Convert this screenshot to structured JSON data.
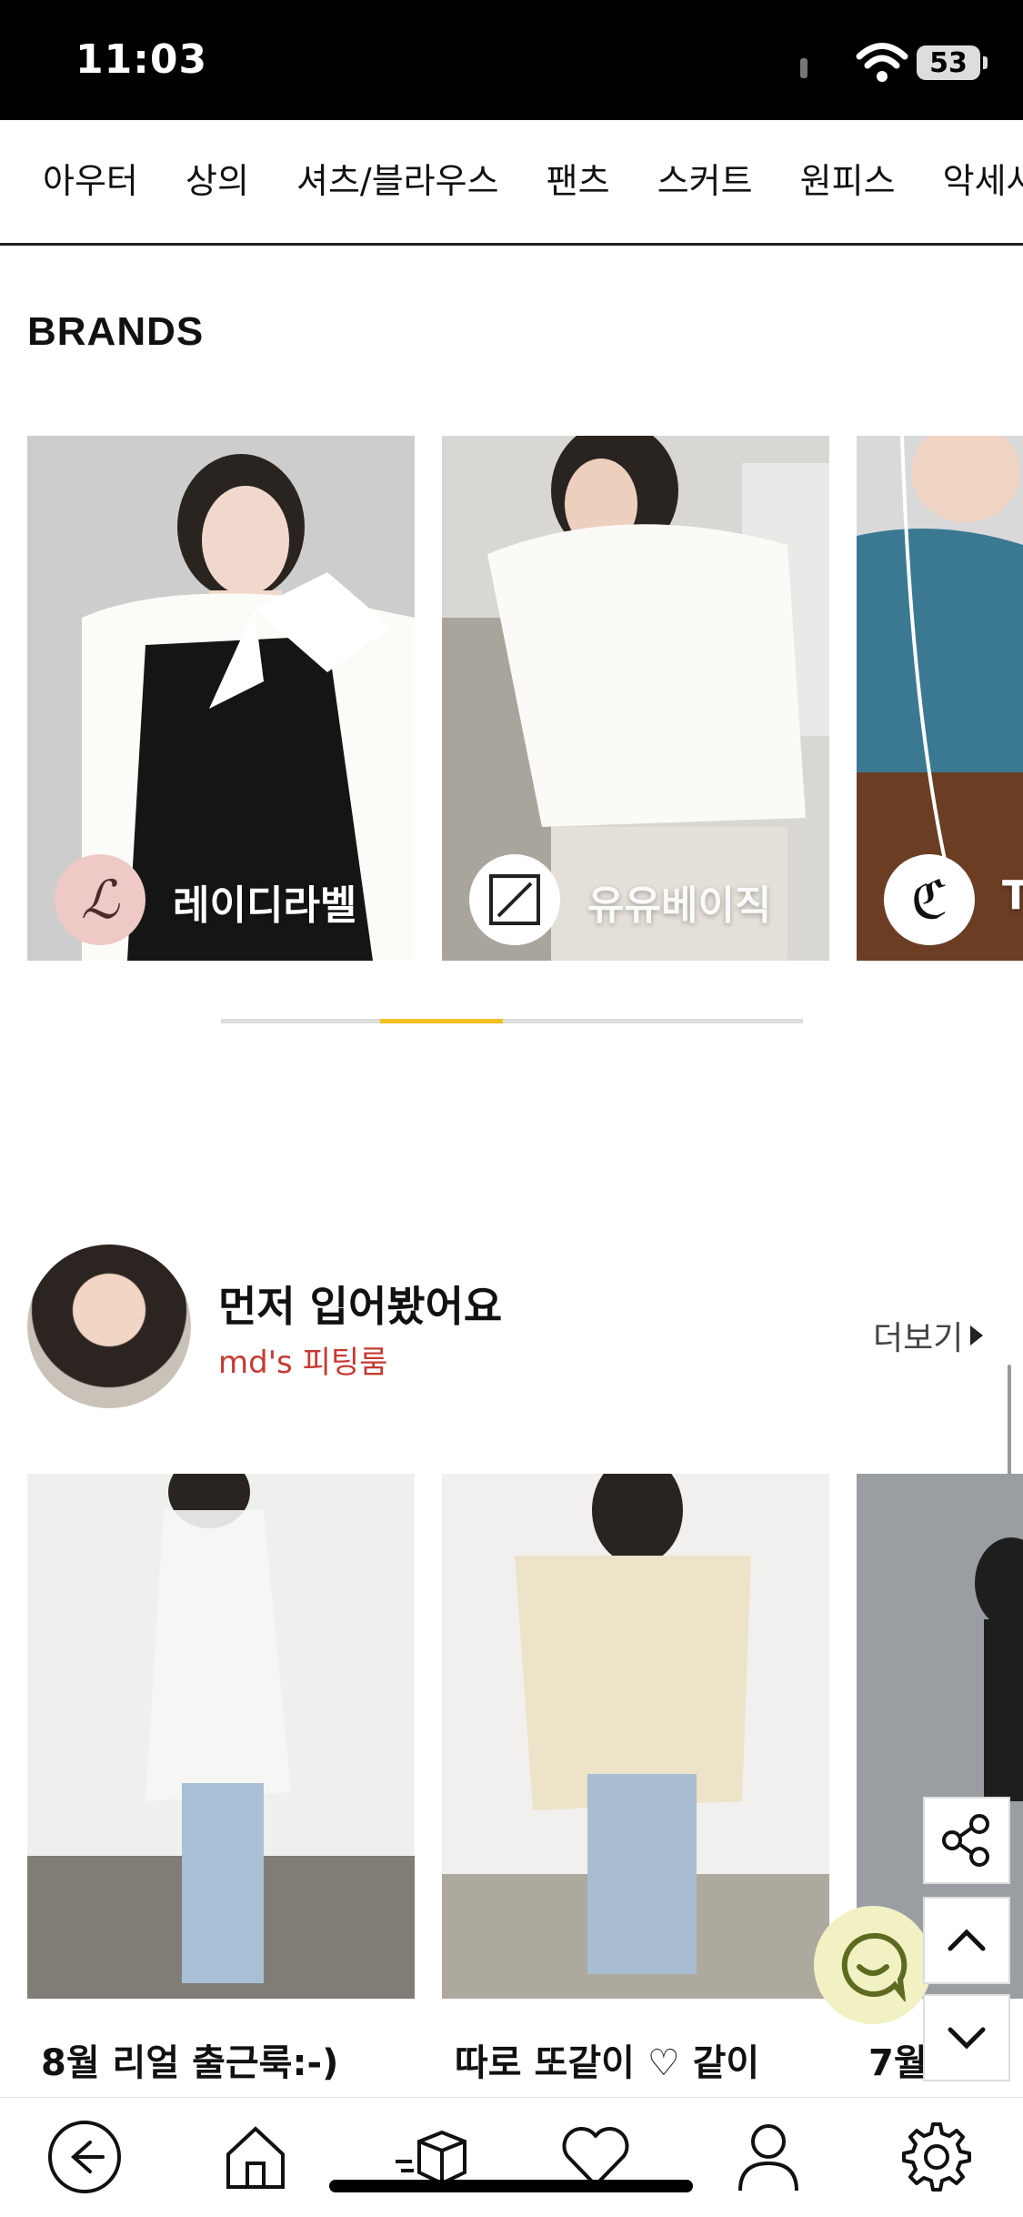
{
  "status_bar": {
    "time": "11:03",
    "battery": "53"
  },
  "categories": [
    "아우터",
    "상의",
    "셔츠/블라우스",
    "팬츠",
    "스커트",
    "원피스",
    "악세사"
  ],
  "brands": {
    "title": "BRANDS",
    "items": [
      {
        "name": "레이디라벨",
        "logo": "ℒ"
      },
      {
        "name": "유유베이직",
        "logo": "⧄"
      },
      {
        "name": "T",
        "logo": "ℭ"
      }
    ],
    "progress": 0.27
  },
  "md_section": {
    "title": "먼저 입어봤어요",
    "subtitle": "md's 피팅룸",
    "more": "더보기"
  },
  "looks": [
    {
      "caption": "8월 리얼 출근룩:-)"
    },
    {
      "caption": "따로 또같이 ♡ 같이"
    },
    {
      "caption": "7월"
    }
  ],
  "floating": {
    "share": "share-icon",
    "up": "chevron-up-icon",
    "down": "chevron-down-icon",
    "chat": "chat-icon"
  },
  "bottom_nav": [
    "back-icon",
    "home-icon",
    "delivery-box-icon",
    "heart-icon",
    "user-icon",
    "settings-icon"
  ]
}
